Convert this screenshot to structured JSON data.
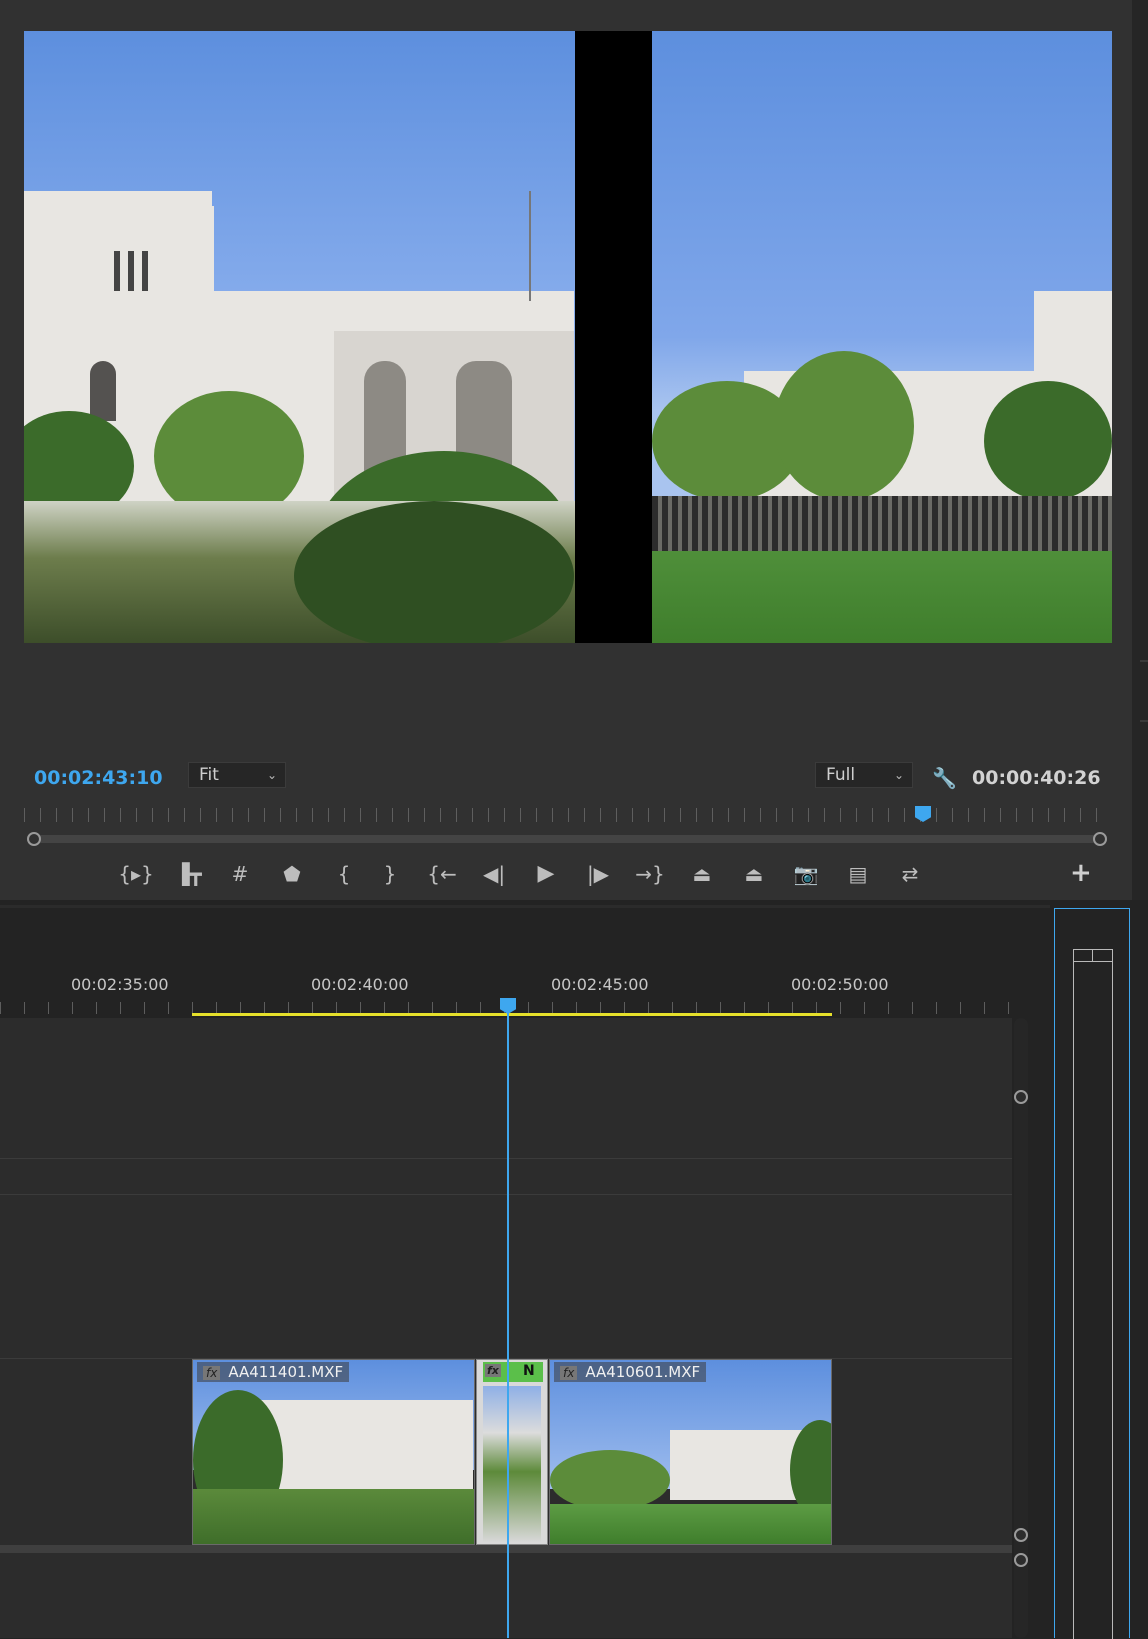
{
  "program_monitor": {
    "playhead_timecode": "00:02:43:10",
    "zoom_select": "Fit",
    "resolution_select": "Full",
    "duration_timecode": "00:00:40:26"
  },
  "transport": {
    "buttons": [
      {
        "name": "add-marker-icon",
        "glyph": "{▸}"
      },
      {
        "name": "mark-in-out-icon",
        "glyph": "▐┳"
      },
      {
        "name": "safe-margins-icon",
        "glyph": "#"
      },
      {
        "name": "marker-icon",
        "glyph": "⬟"
      },
      {
        "name": "mark-in-icon",
        "glyph": "{"
      },
      {
        "name": "mark-out-icon",
        "glyph": "}"
      },
      {
        "name": "go-to-in-icon",
        "glyph": "{←"
      },
      {
        "name": "step-back-icon",
        "glyph": "◀|"
      },
      {
        "name": "play-icon",
        "glyph": "▶"
      },
      {
        "name": "step-forward-icon",
        "glyph": "|▶"
      },
      {
        "name": "go-to-out-icon",
        "glyph": "→}"
      },
      {
        "name": "lift-icon",
        "glyph": "⏏"
      },
      {
        "name": "extract-icon",
        "glyph": "⏏"
      },
      {
        "name": "export-frame-icon",
        "glyph": "📷"
      },
      {
        "name": "comparison-view-icon",
        "glyph": "▤"
      },
      {
        "name": "toggle-proxies-icon",
        "glyph": "⇄"
      }
    ],
    "add_button": "+"
  },
  "timeline": {
    "ruler_times": [
      "00:02:35:00",
      "00:02:40:00",
      "00:02:45:00",
      "00:02:50:00"
    ],
    "clips": [
      {
        "name": "AA411401.MXF",
        "fx": "fx"
      },
      {
        "name": "AA410601.MXF",
        "fx": "fx"
      }
    ],
    "transition": {
      "fx": "fx",
      "label": "N"
    }
  },
  "colors": {
    "accent": "#3ea7ef",
    "work_area": "#e6e02b",
    "transition": "#5bbf4a"
  }
}
